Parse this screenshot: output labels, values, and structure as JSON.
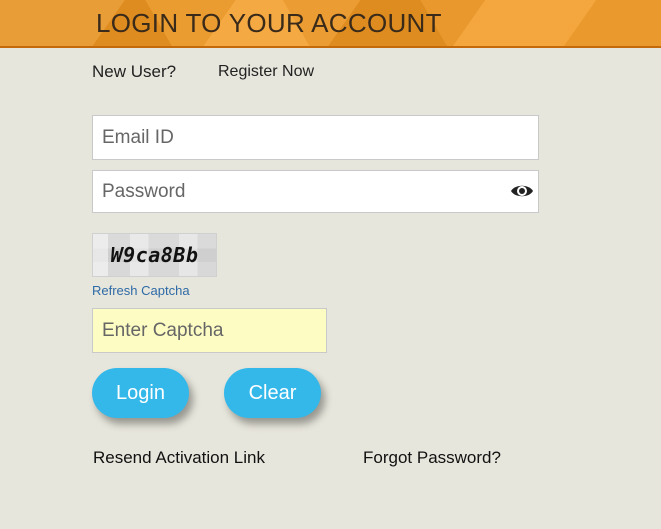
{
  "header": {
    "title": "LOGIN TO YOUR ACCOUNT"
  },
  "register": {
    "prompt": "New User?",
    "link": "Register Now"
  },
  "form": {
    "email_placeholder": "Email ID",
    "password_placeholder": "Password",
    "captcha_code": "W9ca8Bb",
    "refresh_label": "Refresh Captcha",
    "captcha_placeholder": "Enter Captcha"
  },
  "buttons": {
    "login": "Login",
    "clear": "Clear"
  },
  "footer": {
    "resend": "Resend Activation Link",
    "forgot": "Forgot Password?"
  },
  "colors": {
    "header": "#f39a22",
    "button": "#34b8ea",
    "background": "#e7e6dc",
    "captcha_field": "#fdfcc3"
  }
}
